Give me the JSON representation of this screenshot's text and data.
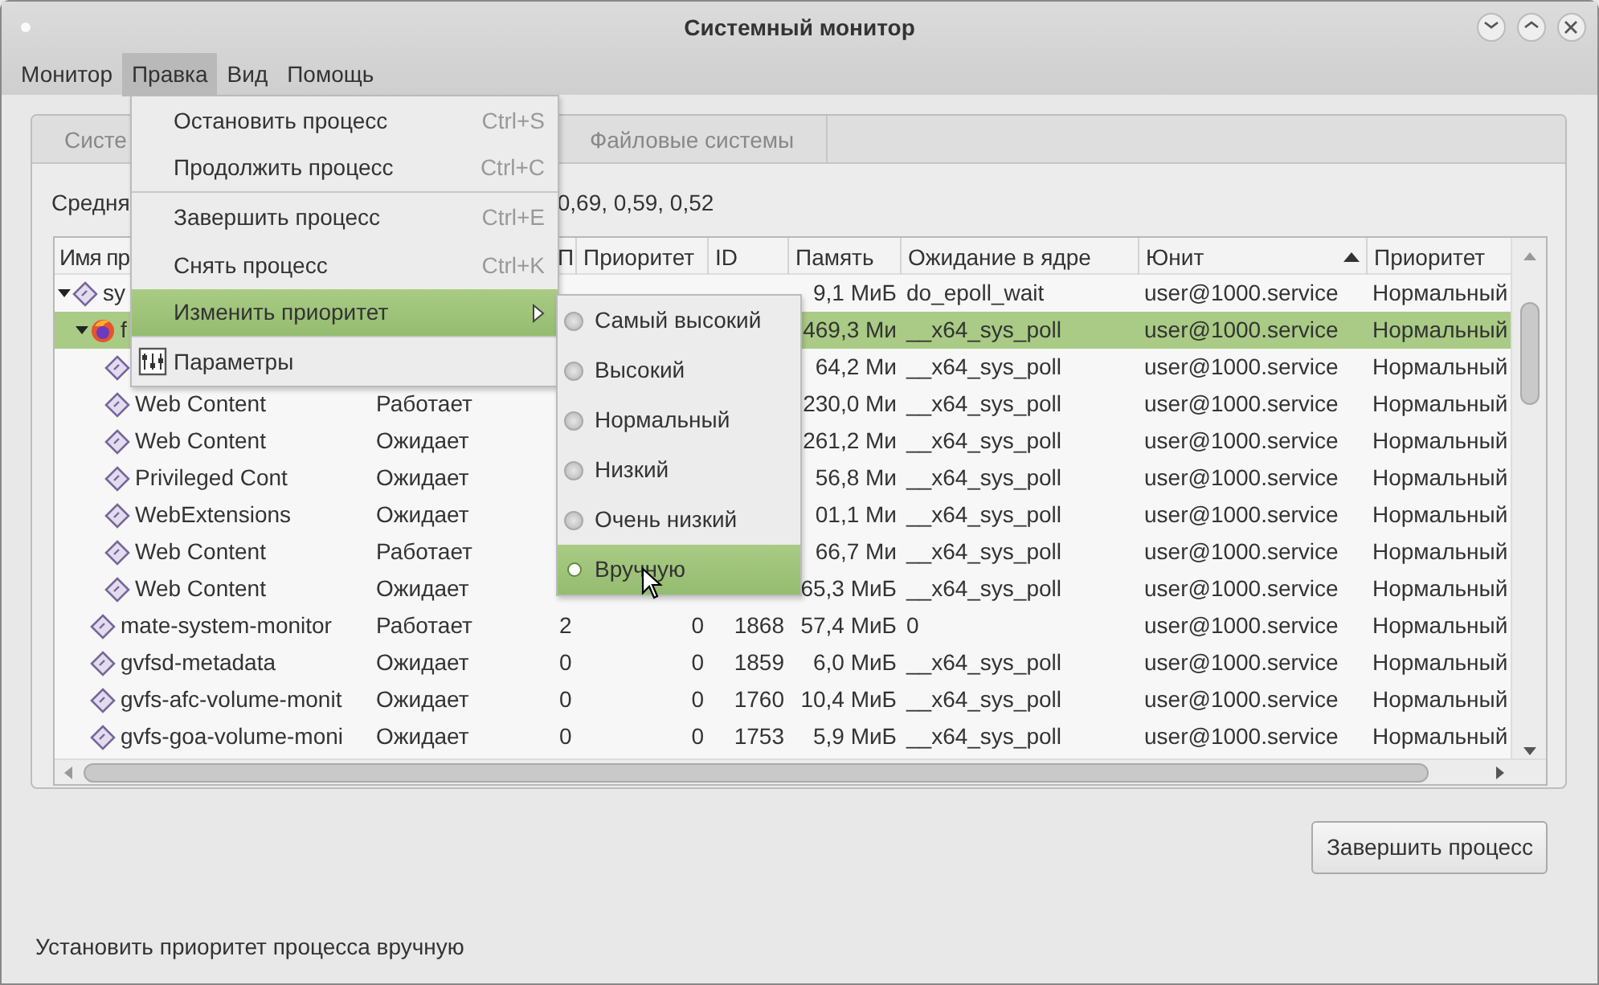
{
  "window": {
    "title": "Системный монитор"
  },
  "menubar": [
    {
      "label": "Монитор",
      "selected": false
    },
    {
      "label": "Правка",
      "selected": true
    },
    {
      "label": "Вид",
      "selected": false
    },
    {
      "label": "Помощь",
      "selected": false
    }
  ],
  "tabs": [
    {
      "label": "Систе",
      "selected": false
    },
    {
      "label": "Файловые системы",
      "selected": false
    }
  ],
  "load_average": {
    "label": "Средня",
    "values": "0,69, 0,59, 0,52"
  },
  "table": {
    "columns": [
      {
        "label": "Имя пр",
        "sorted": false
      },
      {
        "label": "П",
        "sorted": false
      },
      {
        "label": "Приоритет",
        "sorted": false
      },
      {
        "label": "ID",
        "sorted": false
      },
      {
        "label": "Память",
        "sorted": false
      },
      {
        "label": "Ожидание в ядре",
        "sorted": false
      },
      {
        "label": "Юнит",
        "sorted": true
      },
      {
        "label": "Приоритет",
        "sorted": false
      }
    ],
    "rows": [
      {
        "name": "sy",
        "kind": "process",
        "expanded": true,
        "selected": false,
        "memory": "9,1 МиБ",
        "wait": "do_epoll_wait",
        "unit": "user@1000.service",
        "priority": "Нормальный",
        "children": [
          {
            "name": "f",
            "kind": "browser",
            "expanded": true,
            "selected": true,
            "memory": "469,3 Ми",
            "wait": "__x64_sys_poll",
            "unit": "user@1000.service",
            "priority": "Нормальный",
            "children": [
              {
                "kind": "process",
                "selected": false,
                "memory": "64,2 Ми",
                "wait": "__x64_sys_poll",
                "unit": "user@1000.service",
                "priority": "Нормальный"
              },
              {
                "name": "Web Content",
                "kind": "process",
                "selected": false,
                "status": "Работает",
                "memory": "230,0 Ми",
                "wait": "__x64_sys_poll",
                "unit": "user@1000.service",
                "priority": "Нормальный"
              },
              {
                "name": "Web Content",
                "kind": "process",
                "selected": false,
                "status": "Ожидает",
                "memory": "261,2 Ми",
                "wait": "__x64_sys_poll",
                "unit": "user@1000.service",
                "priority": "Нормальный"
              },
              {
                "name": "Privileged Cont",
                "kind": "process",
                "selected": false,
                "status": "Ожидает",
                "memory": "56,8 Ми",
                "wait": "__x64_sys_poll",
                "unit": "user@1000.service",
                "priority": "Нормальный"
              },
              {
                "name": "WebExtensions",
                "kind": "process",
                "selected": false,
                "status": "Ожидает",
                "memory": "01,1 Ми",
                "wait": "__x64_sys_poll",
                "unit": "user@1000.service",
                "priority": "Нормальный"
              },
              {
                "name": "Web Content",
                "kind": "process",
                "selected": false,
                "status": "Работает",
                "memory": "66,7 Ми",
                "wait": "__x64_sys_poll",
                "unit": "user@1000.service",
                "priority": "Нормальный"
              },
              {
                "name": "Web Content",
                "kind": "process",
                "selected": false,
                "status": "Ожидает",
                "memory": "65,3 МиБ",
                "wait": "__x64_sys_poll",
                "unit": "user@1000.service",
                "priority": "Нормальный"
              }
            ]
          },
          {
            "name": "mate-system-monitor",
            "kind": "process",
            "selected": false,
            "status": "Работает",
            "cpu": "2",
            "nice": "0",
            "id": "1868",
            "memory": "57,4 МиБ",
            "wait": "0",
            "unit": "user@1000.service",
            "priority": "Нормальный"
          },
          {
            "name": "gvfsd-metadata",
            "kind": "process",
            "selected": false,
            "status": "Ожидает",
            "cpu": "0",
            "nice": "0",
            "id": "1859",
            "memory": "6,0 МиБ",
            "wait": "__x64_sys_poll",
            "unit": "user@1000.service",
            "priority": "Нормальный"
          },
          {
            "name": "gvfs-afc-volume-monit",
            "kind": "process",
            "selected": false,
            "status": "Ожидает",
            "cpu": "0",
            "nice": "0",
            "id": "1760",
            "memory": "10,4 МиБ",
            "wait": "__x64_sys_poll",
            "unit": "user@1000.service",
            "priority": "Нормальный"
          },
          {
            "name": "gvfs-goa-volume-moni",
            "kind": "process",
            "selected": false,
            "status": "Ожидает",
            "cpu": "0",
            "nice": "0",
            "id": "1753",
            "memory": "5,9 МиБ",
            "wait": "__x64_sys_poll",
            "unit": "user@1000.service",
            "priority": "Нормальный"
          }
        ]
      }
    ]
  },
  "end_process_button": "Завершить процесс",
  "status_bar": "Установить приоритет процесса вручную",
  "edit_menu": [
    {
      "label": "Остановить процесс",
      "shortcut": "Ctrl+S",
      "kind": "item",
      "hovered": false,
      "separator_after": false
    },
    {
      "label": "Продолжить процесс",
      "shortcut": "Ctrl+C",
      "kind": "item",
      "hovered": false,
      "separator_after": true
    },
    {
      "label": "Завершить процесс",
      "shortcut": "Ctrl+E",
      "kind": "item",
      "hovered": false,
      "separator_after": false
    },
    {
      "label": "Снять процесс",
      "shortcut": "Ctrl+K",
      "kind": "item",
      "hovered": false,
      "separator_after": false
    },
    {
      "label": "Изменить приоритет",
      "kind": "submenu",
      "hovered": true,
      "separator_after": true
    },
    {
      "label": "Параметры",
      "kind": "icon_item",
      "hovered": false,
      "separator_after": false
    }
  ],
  "priority_submenu": [
    {
      "label": "Самый высокий",
      "selected": false
    },
    {
      "label": "Высокий",
      "selected": false
    },
    {
      "label": "Нормальный",
      "selected": false
    },
    {
      "label": "Низкий",
      "selected": false
    },
    {
      "label": "Очень низкий",
      "selected": false
    },
    {
      "label": "Вручную",
      "selected": true
    }
  ]
}
